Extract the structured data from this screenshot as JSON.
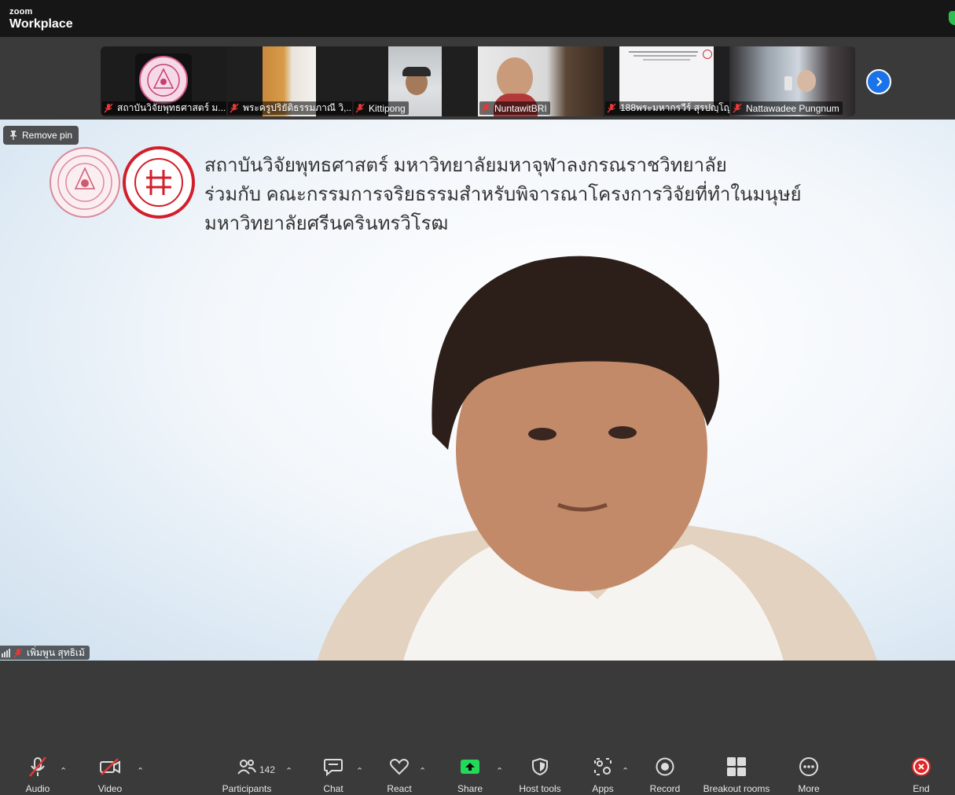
{
  "app": {
    "brand_small": "zoom",
    "brand_big": "Workplace"
  },
  "gallery": {
    "tiles": [
      {
        "name": "สถาบันวิจัยพุทธศาสตร์ ม..."
      },
      {
        "name": "พระครูปริยัติธรรมภาณี วิ,..."
      },
      {
        "name": "Kittipong"
      },
      {
        "name": "NuntawitBRI"
      },
      {
        "name": "188พระมหากรวีร์ สุรปญฺโญ"
      },
      {
        "name": "Nattawadee Pungnum"
      }
    ]
  },
  "main": {
    "remove_pin": "Remove pin",
    "heading_line1": "สถาบันวิจัยพุทธศาสตร์ มหาวิทยาลัยมหาจุฬาลงกรณราชวิทยาลัย",
    "heading_line2": "ร่วมกับ คณะกรรมการจริยธรรมสำหรับพิจารณาโครงการวิจัยที่ทำในมนุษย์",
    "heading_line3": "มหาวิทยาลัยศรีนครินทรวิโรฒ",
    "speaker_name": "เพิ่มพูน สุทธิเม้"
  },
  "toolbar": {
    "audio": "Audio",
    "video": "Video",
    "participants": "Participants",
    "participants_count": "142",
    "chat": "Chat",
    "react": "React",
    "share": "Share",
    "host_tools": "Host tools",
    "apps": "Apps",
    "record": "Record",
    "breakout_rooms": "Breakout rooms",
    "more": "More",
    "end": "End"
  },
  "colors": {
    "accent": "#1a73e8",
    "share": "#23d959",
    "mute_red": "#e53935",
    "end_red": "#e02828"
  }
}
